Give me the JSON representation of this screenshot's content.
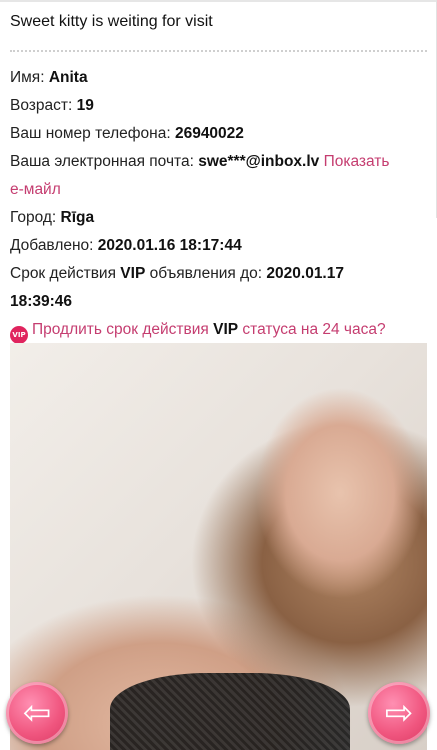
{
  "listing": {
    "title": "Sweet kitty is weiting for visit",
    "name_label": "Имя:",
    "name_value": "Anita",
    "age_label": "Возраст:",
    "age_value": "19",
    "phone_label": "Ваш номер телефона:",
    "phone_value": "26940022",
    "email_label": "Ваша электронная почта:",
    "email_value": "swe***@inbox.lv",
    "email_show_link_1": "Показать",
    "email_show_link_2": "е-майл",
    "city_label": "Город:",
    "city_value": "Rīga",
    "added_label": "Добавлено:",
    "added_value": "2020.01.16 18:17:44",
    "vip_label_pre": "Срок действия ",
    "vip_label_vip": "VIP",
    "vip_label_post": " объявления до:",
    "vip_date": "2020.01.17",
    "vip_time": "18:39:46",
    "extend_badge": "VIP",
    "extend_pre": "Продлить срок действия ",
    "extend_vip": "VIP",
    "extend_post": " статуса на 24 часа?"
  },
  "navigation": {
    "prev_glyph": "⇦",
    "next_glyph": "⇨"
  },
  "colors": {
    "accent": "#c53d70",
    "button": "#f0567f"
  }
}
